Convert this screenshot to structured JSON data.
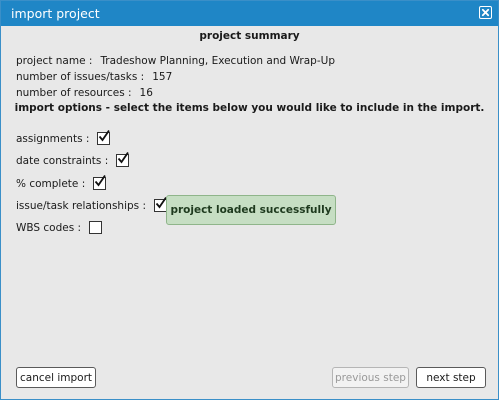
{
  "dialog": {
    "title": "import project",
    "close_icon": "close-icon"
  },
  "summary": {
    "heading": "project summary",
    "project_name_label": "project name :",
    "project_name_value": "Tradeshow Planning, Execution and Wrap-Up",
    "issues_label": "number of issues/tasks :",
    "issues_value": "157",
    "resources_label": "number of resources :",
    "resources_value": "16"
  },
  "options": {
    "heading": "import options - select the items below you would like to include in the import.",
    "items": [
      {
        "label": "assignments :",
        "checked": true
      },
      {
        "label": "date constraints :",
        "checked": true
      },
      {
        "label": "% complete :",
        "checked": true
      },
      {
        "label": "issue/task relationships :",
        "checked": true
      },
      {
        "label": "WBS codes :",
        "checked": false
      }
    ]
  },
  "status": {
    "message": "project loaded successfully",
    "color": "#c6dec3"
  },
  "buttons": {
    "cancel": "cancel import",
    "previous": "previous step",
    "next": "next step"
  },
  "colors": {
    "titlebar": "#1f86c6",
    "dialog_bg": "#e8e8e8"
  }
}
